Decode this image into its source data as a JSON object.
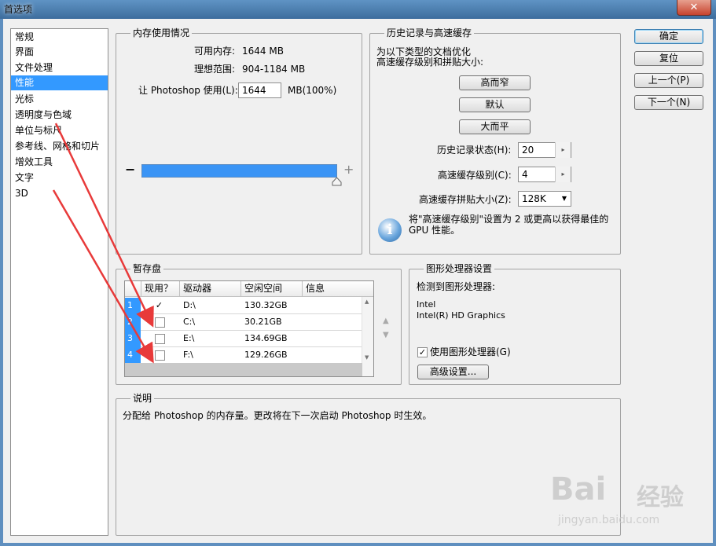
{
  "window": {
    "title": "首选项",
    "close_symbol": "✕"
  },
  "categories": [
    "常规",
    "界面",
    "文件处理",
    "性能",
    "光标",
    "透明度与色域",
    "单位与标尺",
    "参考线、网格和切片",
    "增效工具",
    "文字",
    "3D"
  ],
  "selected_category": "性能",
  "memory": {
    "title": "内存使用情况",
    "available_label": "可用内存:",
    "available_value": "1644 MB",
    "ideal_label": "理想范围:",
    "ideal_value": "904-1184 MB",
    "let_label": "让 Photoshop 使用(L):",
    "let_value": "1644",
    "let_suffix": "MB(100%)",
    "minus": "−",
    "plus": "+",
    "usage_fraction": 1.0
  },
  "history": {
    "title": "历史记录与高速缓存",
    "optimize_line1": "为以下类型的文档优化",
    "optimize_line2": "高速缓存级别和拼贴大小:",
    "btn_tall_thin": "高而窄",
    "btn_default": "默认",
    "btn_big_flat": "大而平",
    "history_states_label": "历史记录状态(H):",
    "history_states_value": "20",
    "cache_levels_label": "高速缓存级别(C):",
    "cache_levels_value": "4",
    "cache_tile_label": "高速缓存拼贴大小(Z):",
    "cache_tile_value": "128K",
    "note_line1": "将\"高速缓存级别\"设置为 2 或更高以获得最佳的",
    "note_line2": "GPU 性能。",
    "note_icon": "i"
  },
  "scratch": {
    "title": "暂存盘",
    "columns": [
      "现用？",
      "驱动器",
      "空闲空间",
      "信息"
    ],
    "rows": [
      {
        "num": "1",
        "active": true,
        "drive": "D:\\",
        "free": "130.32GB"
      },
      {
        "num": "2",
        "active": false,
        "drive": "C:\\",
        "free": "30.21GB"
      },
      {
        "num": "3",
        "active": false,
        "drive": "E:\\",
        "free": "134.69GB"
      },
      {
        "num": "4",
        "active": false,
        "drive": "F:\\",
        "free": "129.26GB"
      }
    ],
    "check_mark": "✓",
    "up_arrow": "▲",
    "down_arrow": "▼"
  },
  "gpu": {
    "title": "图形处理器设置",
    "detected_label": "检测到图形处理器:",
    "vendor": "Intel",
    "model": "Intel(R) HD Graphics",
    "use_gpu_label": "使用图形处理器(G)",
    "use_gpu_checked": true,
    "advanced_button": "高级设置..."
  },
  "description": {
    "title": "说明",
    "text": "分配给 Photoshop 的内存量。更改将在下一次启动 Photoshop 时生效。"
  },
  "buttons": {
    "ok": "确定",
    "reset": "复位",
    "prev": "上一个(P)",
    "next": "下一个(N)"
  },
  "watermark": {
    "logo_text": "Bai",
    "logo_text2": "经验",
    "url": "jingyan.baidu.com"
  },
  "colors": {
    "selection": "#3399ff",
    "annotation_arrow": "#e83a3a",
    "title_bar": "#4a7cae"
  }
}
